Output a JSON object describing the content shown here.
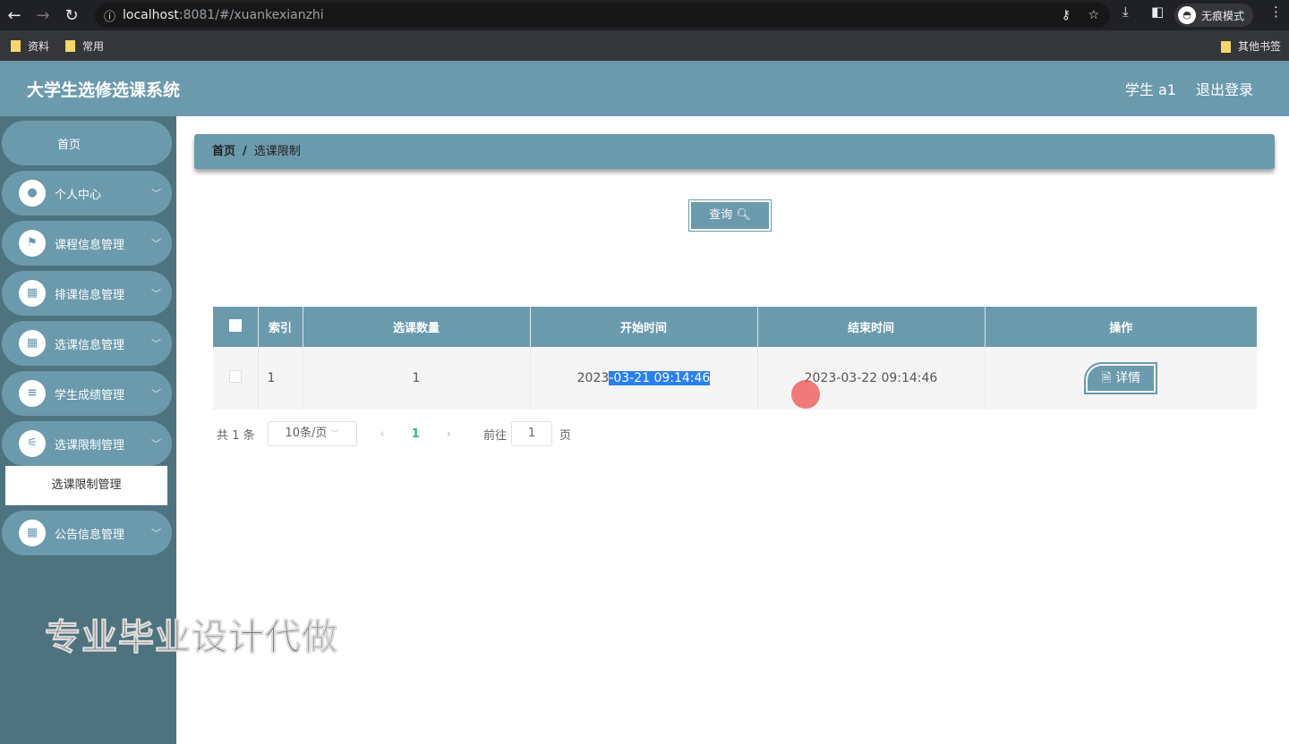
{
  "browser": {
    "url_host": "localhost",
    "url_path": ":8081/#/xuankexianzhi",
    "incognito": "无痕模式",
    "bookmarks": [
      "资料",
      "常用"
    ],
    "other_bookmarks": "其他书签"
  },
  "header": {
    "title": "大学生选修选课系统",
    "user": "学生 a1",
    "logout": "退出登录"
  },
  "sidebar": {
    "home": "首页",
    "items": [
      {
        "label": "个人中心",
        "icon": "user-icon"
      },
      {
        "label": "课程信息管理",
        "icon": "flag-icon"
      },
      {
        "label": "排课信息管理",
        "icon": "grid-icon"
      },
      {
        "label": "选课信息管理",
        "icon": "grid-icon"
      },
      {
        "label": "学生成绩管理",
        "icon": "list-icon"
      },
      {
        "label": "选课限制管理",
        "icon": "sliders-icon"
      },
      {
        "label": "公告信息管理",
        "icon": "grid-icon"
      }
    ],
    "submenu": "选课限制管理"
  },
  "breadcrumb": {
    "home": "首页",
    "sep": "/",
    "current": "选课限制"
  },
  "query_button": "查询",
  "table": {
    "headers": [
      "索引",
      "选课数量",
      "开始时间",
      "结束时间",
      "操作"
    ],
    "rows": [
      {
        "index": "1",
        "count": "1",
        "start_a": "2023",
        "start_b": "-03-21 09:14:46",
        "end": "2023-03-22 09:14:46",
        "action": "详情"
      }
    ]
  },
  "pagination": {
    "total": "共 1 条",
    "page_size": "10条/页",
    "current": "1",
    "goto": "前往",
    "goto_value": "1",
    "page_unit": "页"
  },
  "watermark": "专业毕业设计代做"
}
